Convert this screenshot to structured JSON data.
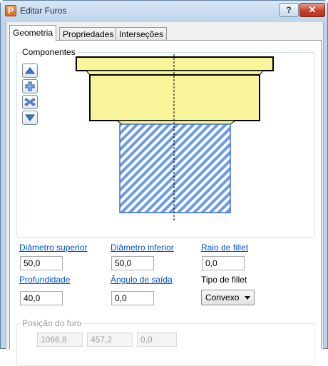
{
  "window": {
    "title": "Editar Furos"
  },
  "titlebar_buttons": {
    "help": "?",
    "close": "✕"
  },
  "tabs": [
    {
      "label": "Geometria",
      "active": true
    },
    {
      "label": "Propriedades",
      "active": false
    },
    {
      "label": "Interseções",
      "active": false
    }
  ],
  "components": {
    "legend": "Componentes",
    "side_buttons": [
      "up-arrow-icon",
      "add-icon",
      "delete-icon",
      "down-arrow-icon"
    ],
    "colors": {
      "top_part": "#f8f49a",
      "hatch": "#6a9ae8",
      "outline": "#000000"
    }
  },
  "fields": {
    "diametro_superior": {
      "label": "Diâmetro superior",
      "value": "50,0"
    },
    "diametro_inferior": {
      "label": "Diâmetro inferior",
      "value": "50,0"
    },
    "raio_fillet": {
      "label": "Raio de fillet",
      "value": "0,0"
    },
    "profundidade": {
      "label": "Profundidade",
      "value": "40,0"
    },
    "angulo_saida": {
      "label": "Ângulo de saída",
      "value": "0,0"
    },
    "tipo_fillet": {
      "label": "Tipo de fillet",
      "value": "Convexo"
    }
  },
  "position": {
    "legend": "Posição do furo",
    "x": "1066,8",
    "y": "457,2",
    "z": "0,0"
  }
}
